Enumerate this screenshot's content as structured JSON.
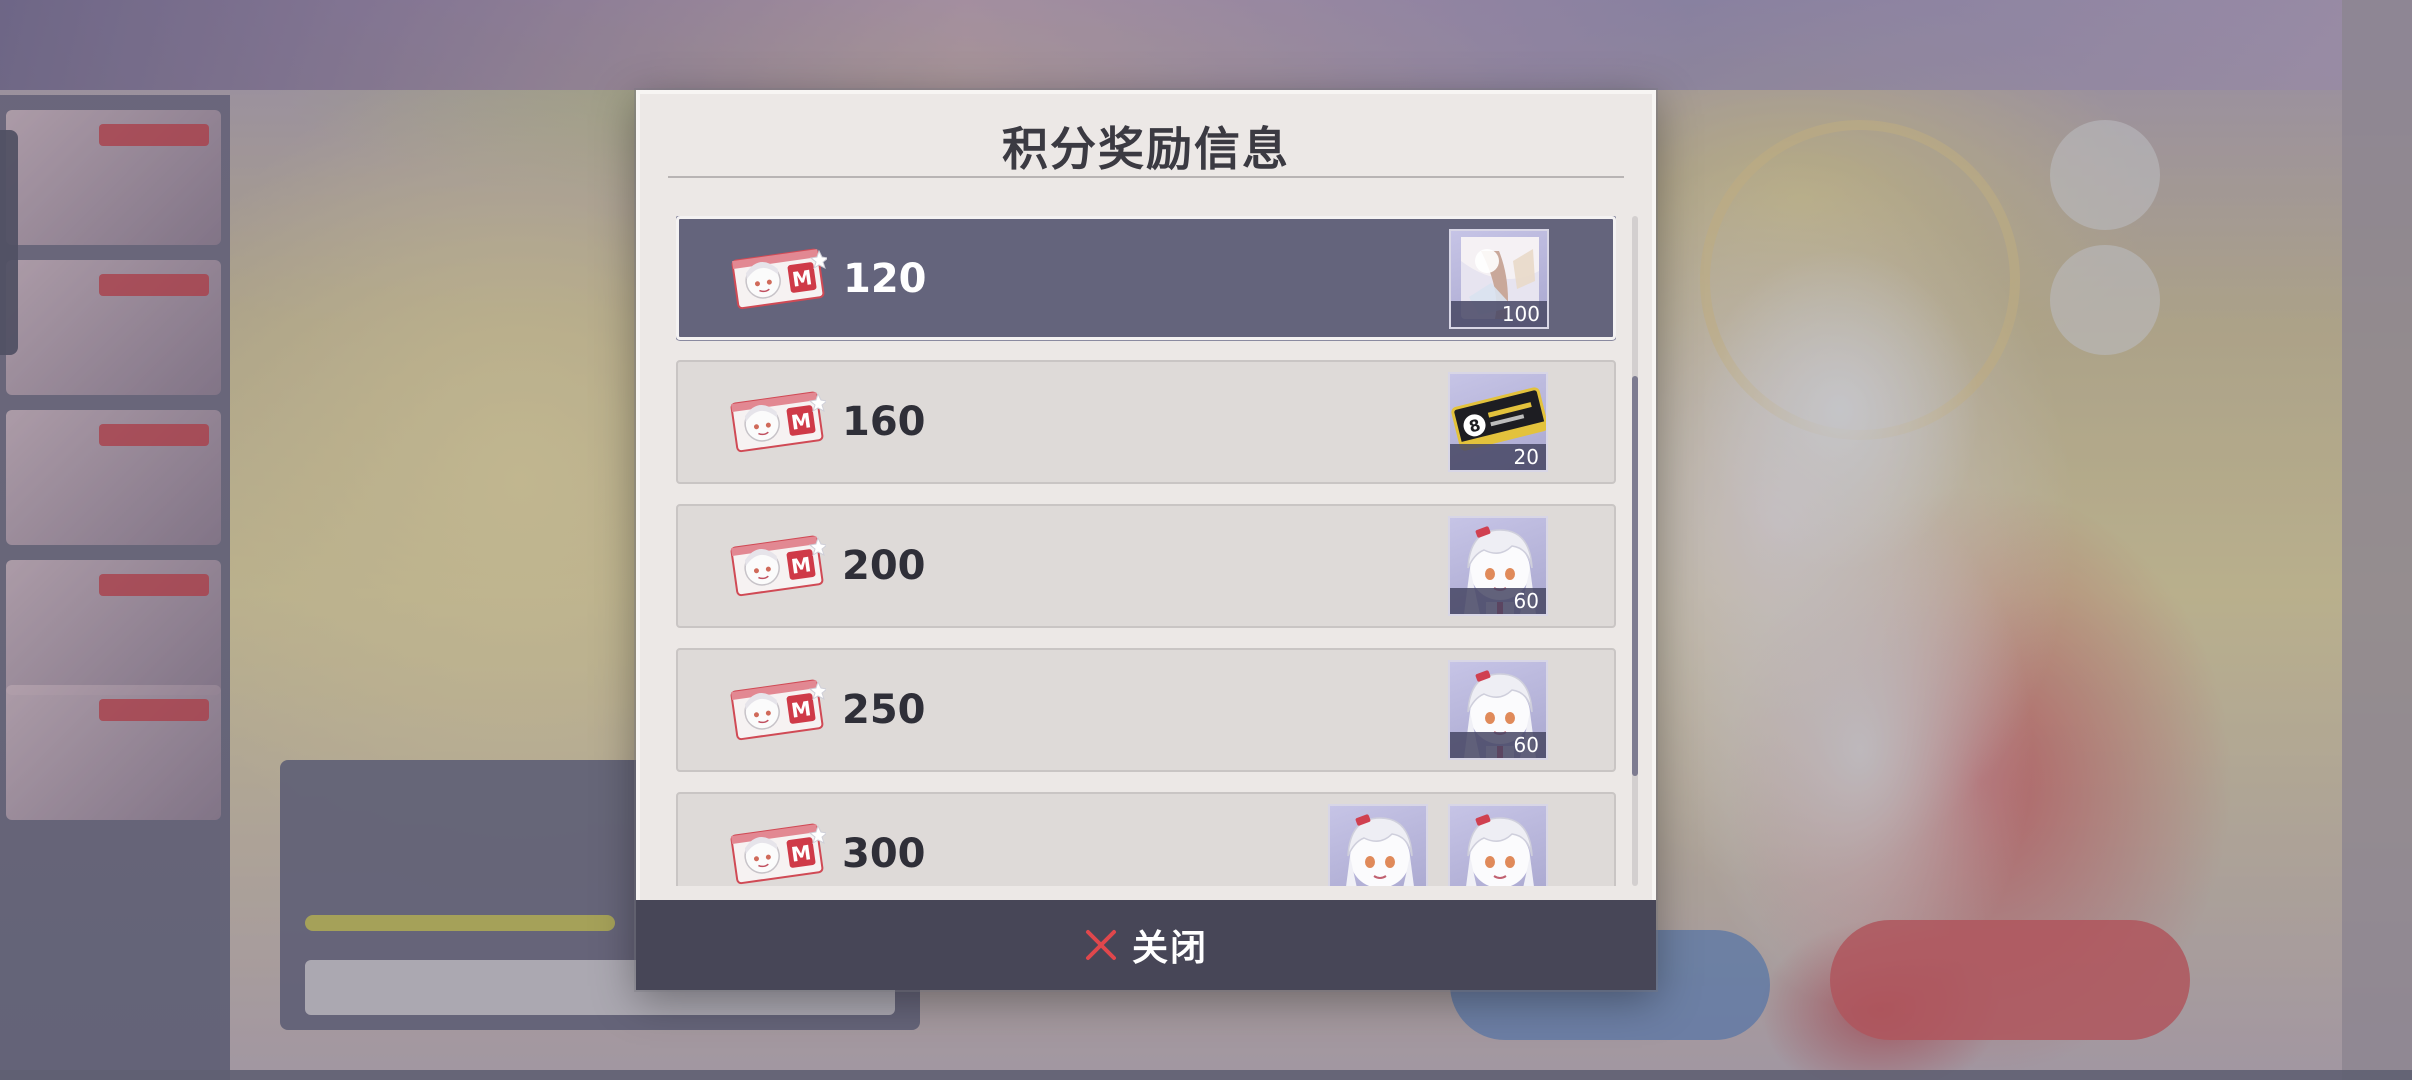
{
  "dialog": {
    "title": "积分奖励信息",
    "close_label": "关闭"
  },
  "rewards": [
    {
      "points": "120",
      "selected": true,
      "items": [
        {
          "icon": "gacha-pack-icon",
          "qty": "100"
        }
      ]
    },
    {
      "points": "160",
      "selected": false,
      "items": [
        {
          "icon": "black-ticket-icon",
          "qty": "20"
        }
      ]
    },
    {
      "points": "200",
      "selected": false,
      "items": [
        {
          "icon": "character-portrait-icon",
          "qty": "60"
        }
      ]
    },
    {
      "points": "250",
      "selected": false,
      "items": [
        {
          "icon": "character-portrait-icon",
          "qty": "60"
        }
      ]
    },
    {
      "points": "300",
      "selected": false,
      "items": [
        {
          "icon": "character-portrait-icon",
          "qty": ""
        },
        {
          "icon": "character-portrait-icon",
          "qty": ""
        }
      ]
    }
  ],
  "colors": {
    "modal_bg": "#ece8e6",
    "row_bg": "#dedad8",
    "row_selected_bg": "#64647c",
    "close_bar_bg": "#474657",
    "close_icon": "#e0474c"
  }
}
